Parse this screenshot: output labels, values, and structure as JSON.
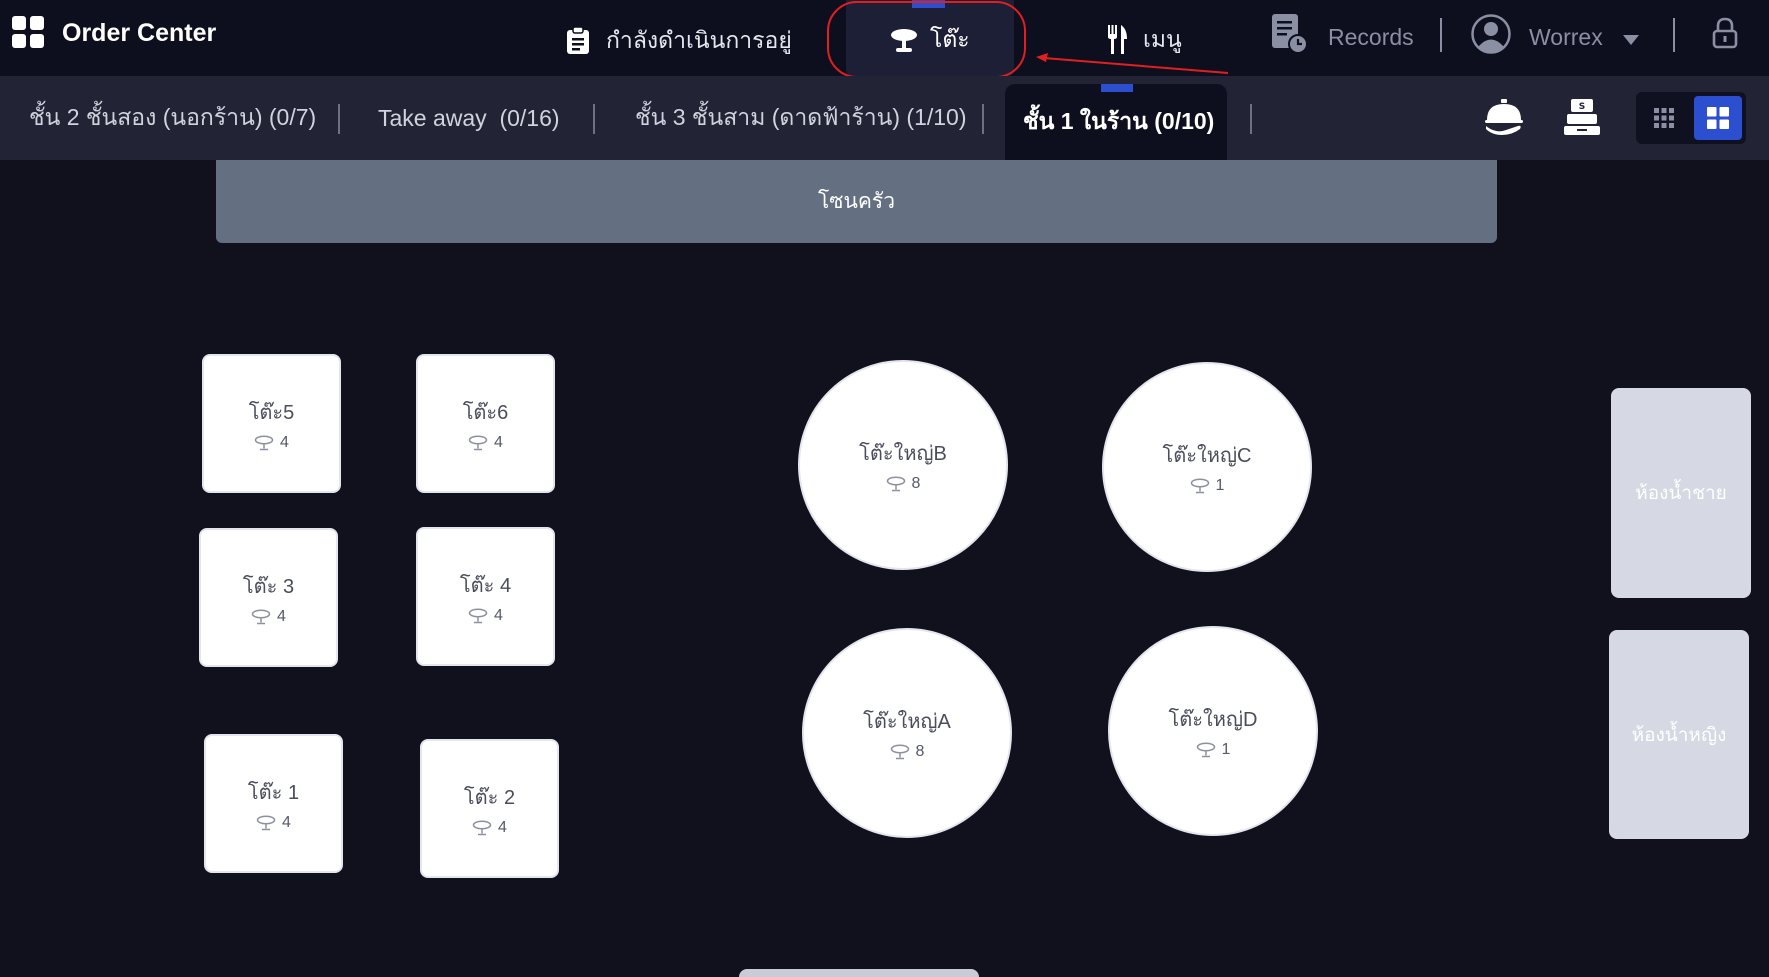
{
  "app": {
    "title": "Order Center"
  },
  "nav": {
    "in_progress": "กำลังดำเนินการอยู่",
    "tables": "โต๊ะ",
    "menu": "เมนู",
    "records": "Records",
    "user": "Worrex"
  },
  "zones": [
    {
      "label": "ชั้น 2 ชั้นสอง (นอกร้าน) (0/7)"
    },
    {
      "label": "Take away  (0/16)"
    },
    {
      "label": "ชั้น 3 ชั้นสาม (ดาดฟ้าร้าน) (1/10)"
    },
    {
      "label": "ชั้น 1 ในร้าน (0/10)",
      "active": true
    }
  ],
  "floor": {
    "kitchen_label": "โซนครัว",
    "tables": [
      {
        "name": "โต๊ะ5",
        "seats": "4"
      },
      {
        "name": "โต๊ะ6",
        "seats": "4"
      },
      {
        "name": "โต๊ะ 3",
        "seats": "4"
      },
      {
        "name": "โต๊ะ 4",
        "seats": "4"
      },
      {
        "name": "โต๊ะ 1",
        "seats": "4"
      },
      {
        "name": "โต๊ะ 2",
        "seats": "4"
      },
      {
        "name": "โต๊ะใหญ่B",
        "seats": "8"
      },
      {
        "name": "โต๊ะใหญ่C",
        "seats": "1"
      },
      {
        "name": "โต๊ะใหญ่A",
        "seats": "8"
      },
      {
        "name": "โต๊ะใหญ่D",
        "seats": "1"
      }
    ],
    "rooms": [
      {
        "label": "ห้องน้ำชาย"
      },
      {
        "label": "ห้องน้ำหญิง"
      }
    ]
  },
  "icons": {
    "app": "grid-icon",
    "in_progress": "clipboard-icon",
    "tables": "table-icon",
    "menu": "fork-knife-icon",
    "records": "records-clock-icon",
    "user": "user-avatar-icon",
    "dropdown": "caret-down-icon",
    "lock": "lock-icon",
    "serve": "cloche-icon",
    "cashier": "cash-register-icon",
    "grid_small": "grid-small-icon",
    "grid_large": "grid-large-icon"
  },
  "colors": {
    "accent": "#2c4fcf",
    "background": "#10111c",
    "annotation": "#e02020"
  }
}
